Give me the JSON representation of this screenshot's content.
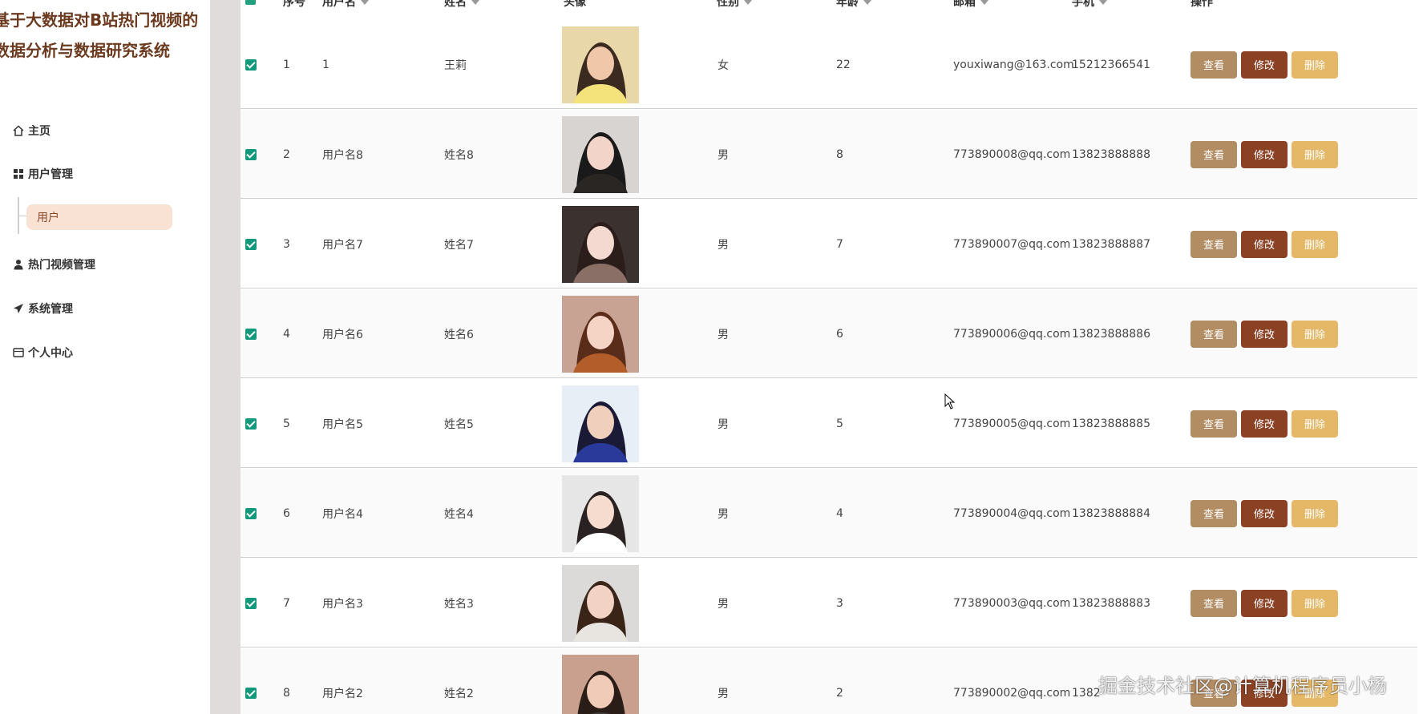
{
  "app": {
    "title": "基于大数据对B站热门视频的数据分析与数据研究系统"
  },
  "sidebar": {
    "items": [
      {
        "label": "主页",
        "icon": "home-icon"
      },
      {
        "label": "用户管理",
        "icon": "grid-icon"
      },
      {
        "label": "热门视频管理",
        "icon": "user-icon"
      },
      {
        "label": "系统管理",
        "icon": "send-icon"
      },
      {
        "label": "个人中心",
        "icon": "card-icon"
      }
    ],
    "submenu": {
      "label": "用户"
    }
  },
  "table": {
    "headers": {
      "index": "序号",
      "username": "用户名",
      "name": "姓名",
      "avatar": "头像",
      "gender": "性别",
      "age": "年龄",
      "email": "邮箱",
      "phone": "手机",
      "actions": "操作"
    },
    "rows": [
      {
        "index": "1",
        "username": "1",
        "name": "王莉",
        "gender": "女",
        "age": "22",
        "email": "youxiwang@163.com",
        "phone": "15212366541",
        "checked": true
      },
      {
        "index": "2",
        "username": "用户名8",
        "name": "姓名8",
        "gender": "男",
        "age": "8",
        "email": "773890008@qq.com",
        "phone": "13823888888",
        "checked": true
      },
      {
        "index": "3",
        "username": "用户名7",
        "name": "姓名7",
        "gender": "男",
        "age": "7",
        "email": "773890007@qq.com",
        "phone": "13823888887",
        "checked": true
      },
      {
        "index": "4",
        "username": "用户名6",
        "name": "姓名6",
        "gender": "男",
        "age": "6",
        "email": "773890006@qq.com",
        "phone": "13823888886",
        "checked": true
      },
      {
        "index": "5",
        "username": "用户名5",
        "name": "姓名5",
        "gender": "男",
        "age": "5",
        "email": "773890005@qq.com",
        "phone": "13823888885",
        "checked": true
      },
      {
        "index": "6",
        "username": "用户名4",
        "name": "姓名4",
        "gender": "男",
        "age": "4",
        "email": "773890004@qq.com",
        "phone": "13823888884",
        "checked": true
      },
      {
        "index": "7",
        "username": "用户名3",
        "name": "姓名3",
        "gender": "男",
        "age": "3",
        "email": "773890003@qq.com",
        "phone": "13823888883",
        "checked": true
      },
      {
        "index": "8",
        "username": "用户名2",
        "name": "姓名2",
        "gender": "男",
        "age": "2",
        "email": "773890002@qq.com",
        "phone": "1382",
        "checked": true
      }
    ],
    "buttons": {
      "view": "查看",
      "edit": "修改",
      "delete": "删除"
    }
  },
  "watermark": "掘金技术社区@计算机程序员小杨",
  "colors": {
    "brand": "#6b3a1f",
    "submenu_bg": "#f9e1d3",
    "checkbox": "#12987a",
    "btn_view": "#b28c63",
    "btn_edit": "#8b4224",
    "btn_delete": "#e5b867"
  }
}
